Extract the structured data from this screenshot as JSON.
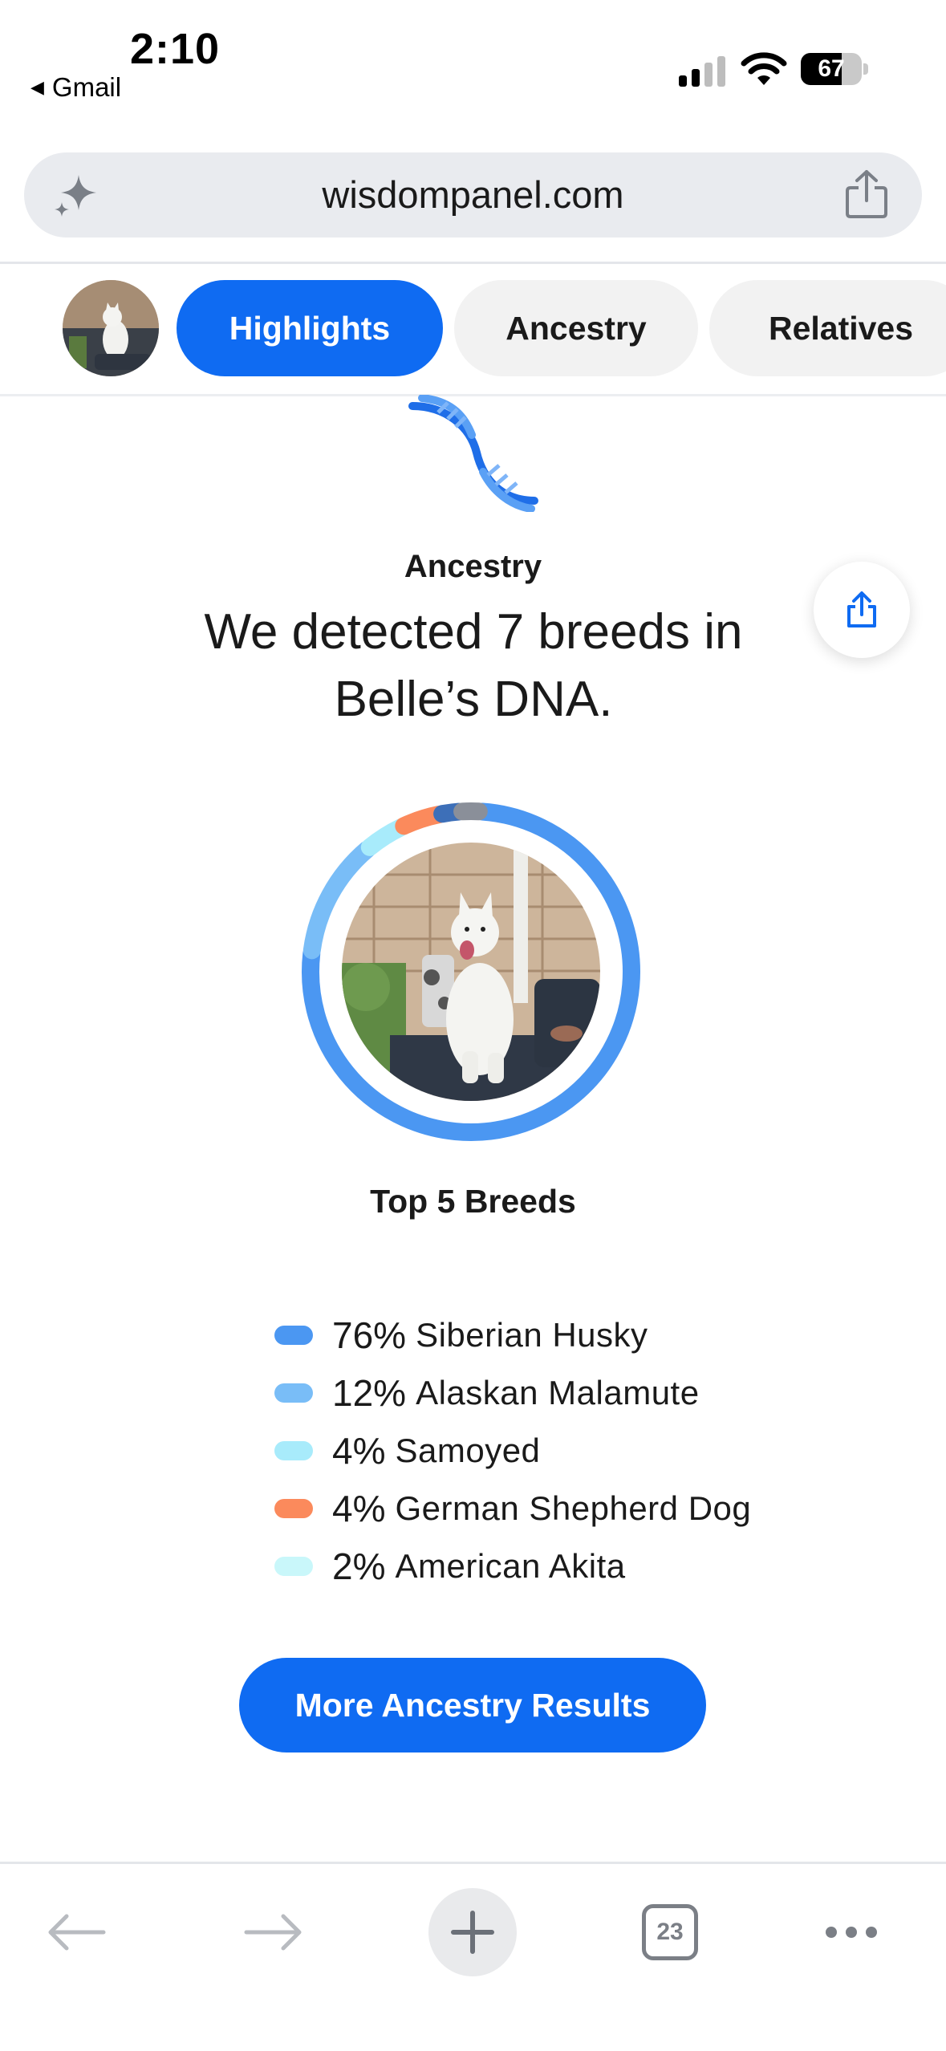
{
  "status_bar": {
    "time": "2:10",
    "back_app": "Gmail",
    "battery": 67
  },
  "url_bar": {
    "domain": "wisdompanel.com"
  },
  "tabs": [
    {
      "label": "Highlights",
      "active": true
    },
    {
      "label": "Ancestry",
      "active": false
    },
    {
      "label": "Relatives",
      "active": false
    }
  ],
  "ancestry": {
    "section_label": "Ancestry",
    "headline": "We detected 7 breeds in Belle’s DNA.",
    "top_breeds_title": "Top 5 Breeds",
    "breeds": [
      {
        "pct": "76%",
        "name": "Siberian Husky",
        "color": "#4b97f2"
      },
      {
        "pct": "12%",
        "name": "Alaskan Malamute",
        "color": "#79bdf7"
      },
      {
        "pct": "4%",
        "name": "Samoyed",
        "color": "#a8ebfb"
      },
      {
        "pct": "4%",
        "name": "German Shepherd Dog",
        "color": "#fb8a5c"
      },
      {
        "pct": "2%",
        "name": "American Akita",
        "color": "#c9f7fa"
      }
    ],
    "ring_segments": [
      {
        "fraction": 0.76,
        "color": "#4b97f2"
      },
      {
        "fraction": 0.12,
        "color": "#79bdf7"
      },
      {
        "fraction": 0.04,
        "color": "#a8ebfb"
      },
      {
        "fraction": 0.04,
        "color": "#fb8a5c"
      },
      {
        "fraction": 0.02,
        "color": "#3d6fb8"
      },
      {
        "fraction": 0.02,
        "color": "#8a8f99"
      }
    ],
    "cta_label": "More Ancestry Results"
  },
  "toolbar": {
    "tab_count": "23"
  },
  "colors": {
    "accent": "#0f6bf2"
  }
}
